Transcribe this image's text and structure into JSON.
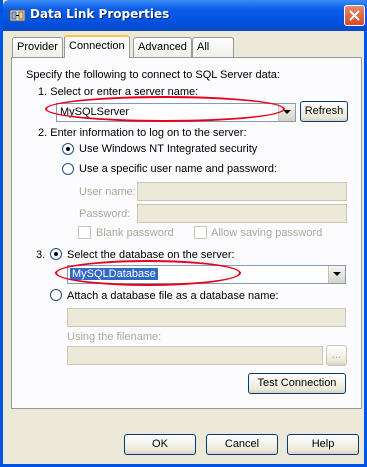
{
  "window": {
    "title": "Data Link Properties",
    "close_icon": "close-icon",
    "app_icon": "data-link-icon"
  },
  "tabs": [
    {
      "label": "Provider",
      "active": false
    },
    {
      "label": "Connection",
      "active": true
    },
    {
      "label": "Advanced",
      "active": false
    },
    {
      "label": "All",
      "active": false
    }
  ],
  "connection": {
    "intro": "Specify the following to connect to SQL Server data:",
    "step1_label": "1. Select or enter a server name:",
    "server_value": "MySQLServer",
    "refresh_label": "Refresh",
    "step2_label": "2. Enter information to log on to the server:",
    "radio_nt_label": "Use Windows NT Integrated security",
    "radio_specific_label": "Use a specific user name and password:",
    "username_label": "User name:",
    "password_label": "Password:",
    "blank_password_label": "Blank password",
    "allow_saving_label": "Allow saving password",
    "step3_label": "3.",
    "radio_select_db_label": "Select the database on the server:",
    "database_value": "MySQLDatabase",
    "radio_attach_label": "Attach a database file as a database name:",
    "filename_label": "Using the filename:",
    "browse_label": "...",
    "test_connection_label": "Test Connection"
  },
  "footer": {
    "ok_label": "OK",
    "cancel_label": "Cancel",
    "help_label": "Help"
  },
  "state": {
    "nt_security_selected": true,
    "select_db_selected": true,
    "highlight_color": "#e8001c",
    "title_color": "#0054e3"
  }
}
